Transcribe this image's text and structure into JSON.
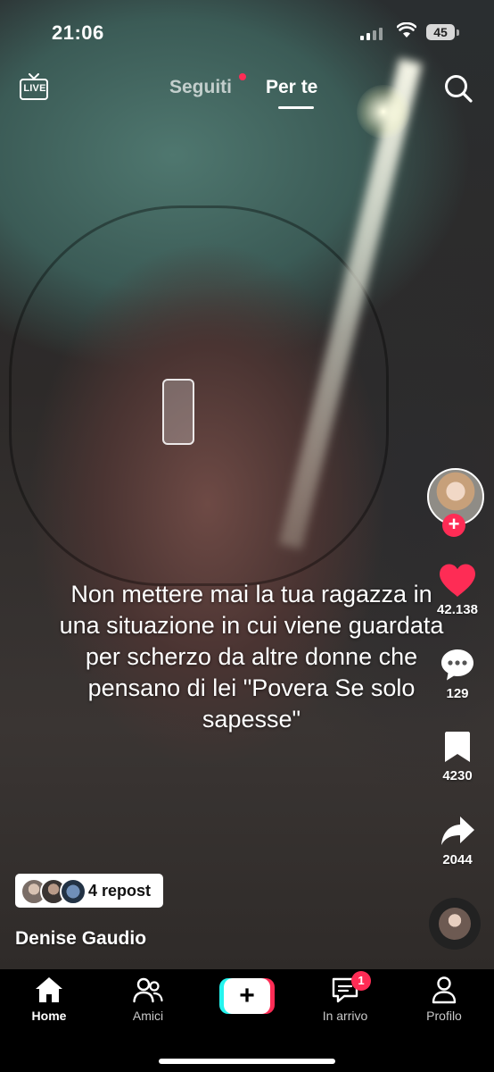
{
  "status_bar": {
    "time": "21:06",
    "battery": "45"
  },
  "top_nav": {
    "live_label": "LIVE",
    "tabs": [
      {
        "label": "Seguiti",
        "active": false,
        "has_dot": true
      },
      {
        "label": "Per te",
        "active": true
      }
    ]
  },
  "video": {
    "caption": "Non mettere mai la tua ragazza in una situazione in cui viene guardata per scherzo da altre donne che pensano di lei  \"Povera Se solo sapesse\"",
    "author": "Denise Gaudio",
    "repost_label": "4 repost"
  },
  "actions": {
    "likes": "42.138",
    "comments": "129",
    "bookmarks": "4230",
    "shares": "2044"
  },
  "bottom_nav": {
    "items": [
      {
        "label": "Home",
        "active": true
      },
      {
        "label": "Amici"
      },
      {
        "label": "In arrivo",
        "badge": "1"
      },
      {
        "label": "Profilo"
      }
    ],
    "create_label": "+"
  },
  "colors": {
    "accent": "#fe2c55",
    "cyan": "#25f4ee",
    "like": "#fe2c55"
  }
}
